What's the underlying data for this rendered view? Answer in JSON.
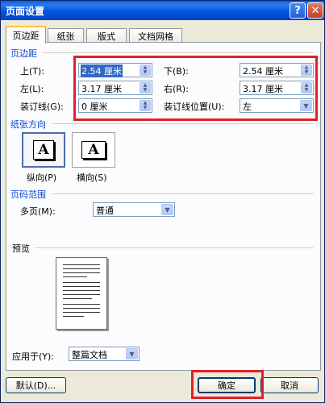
{
  "window": {
    "title": "页面设置",
    "help_label": "?",
    "close_label": "✕"
  },
  "tabs": [
    {
      "label": "页边距"
    },
    {
      "label": "纸张"
    },
    {
      "label": "版式"
    },
    {
      "label": "文档网格"
    }
  ],
  "margins": {
    "section_title": "页边距",
    "top_label": "上(T):",
    "top_value": "2.54 厘米",
    "bottom_label": "下(B):",
    "bottom_value": "2.54 厘米",
    "left_label": "左(L):",
    "left_value": "3.17 厘米",
    "right_label": "右(R):",
    "right_value": "3.17 厘米",
    "gutter_label": "装订线(G):",
    "gutter_value": "0 厘米",
    "gutter_pos_label": "装订线位置(U):",
    "gutter_pos_value": "左"
  },
  "orientation": {
    "section_title": "纸张方向",
    "portrait_label": "纵向(P)",
    "landscape_label": "横向(S)",
    "icon_letter": "A",
    "selected": "portrait"
  },
  "pages": {
    "section_title": "页码范围",
    "multiple_label": "多页(M):",
    "multiple_value": "普通"
  },
  "preview": {
    "section_title": "预览"
  },
  "apply": {
    "label": "应用于(Y):",
    "value": "整篇文档"
  },
  "buttons": {
    "default": "默认(D)...",
    "ok": "确定",
    "cancel": "取消"
  },
  "colors": {
    "section_title": "#0046d5",
    "highlight": "#e0202a",
    "titlebar": "#0054e3"
  }
}
